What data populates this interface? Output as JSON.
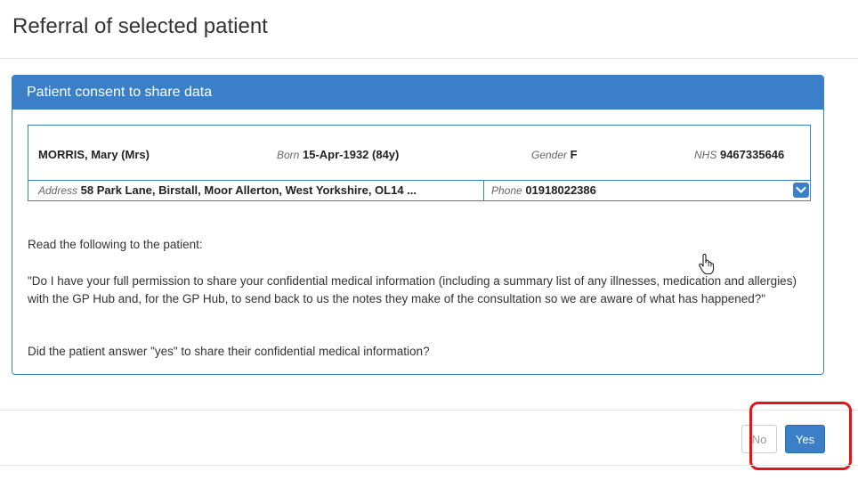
{
  "modal": {
    "title": "Referral of selected patient"
  },
  "panel": {
    "heading": "Patient consent to share data"
  },
  "patient": {
    "name": "MORRIS, Mary (Mrs)",
    "born_label": "Born",
    "born_value": "15-Apr-1932 (84y)",
    "gender_label": "Gender",
    "gender_value": "F",
    "nhs_label": "NHS",
    "nhs_value": "9467335646",
    "address_label": "Address",
    "address_value": "58 Park Lane, Birstall, Moor Allerton, West Yorkshire, OL14 ...",
    "phone_label": "Phone",
    "phone_value": "01918022386",
    "expand_icon": "chevron-down-icon"
  },
  "consent": {
    "instruction": "Read the following to the patient:",
    "quote": "\"Do I have your full permission to share your confidential medical information (including a summary list of any illnesses, medication and allergies) with the GP Hub and, for the GP Hub, to send back to us the notes they make of the consultation so we are aware of what has happened?\"",
    "question": "Did the patient answer \"yes\" to share their confidential medical information?"
  },
  "footer": {
    "no_label": "No",
    "yes_label": "Yes"
  },
  "colors": {
    "accent": "#3a7fc8",
    "highlight": "#e3141b"
  }
}
